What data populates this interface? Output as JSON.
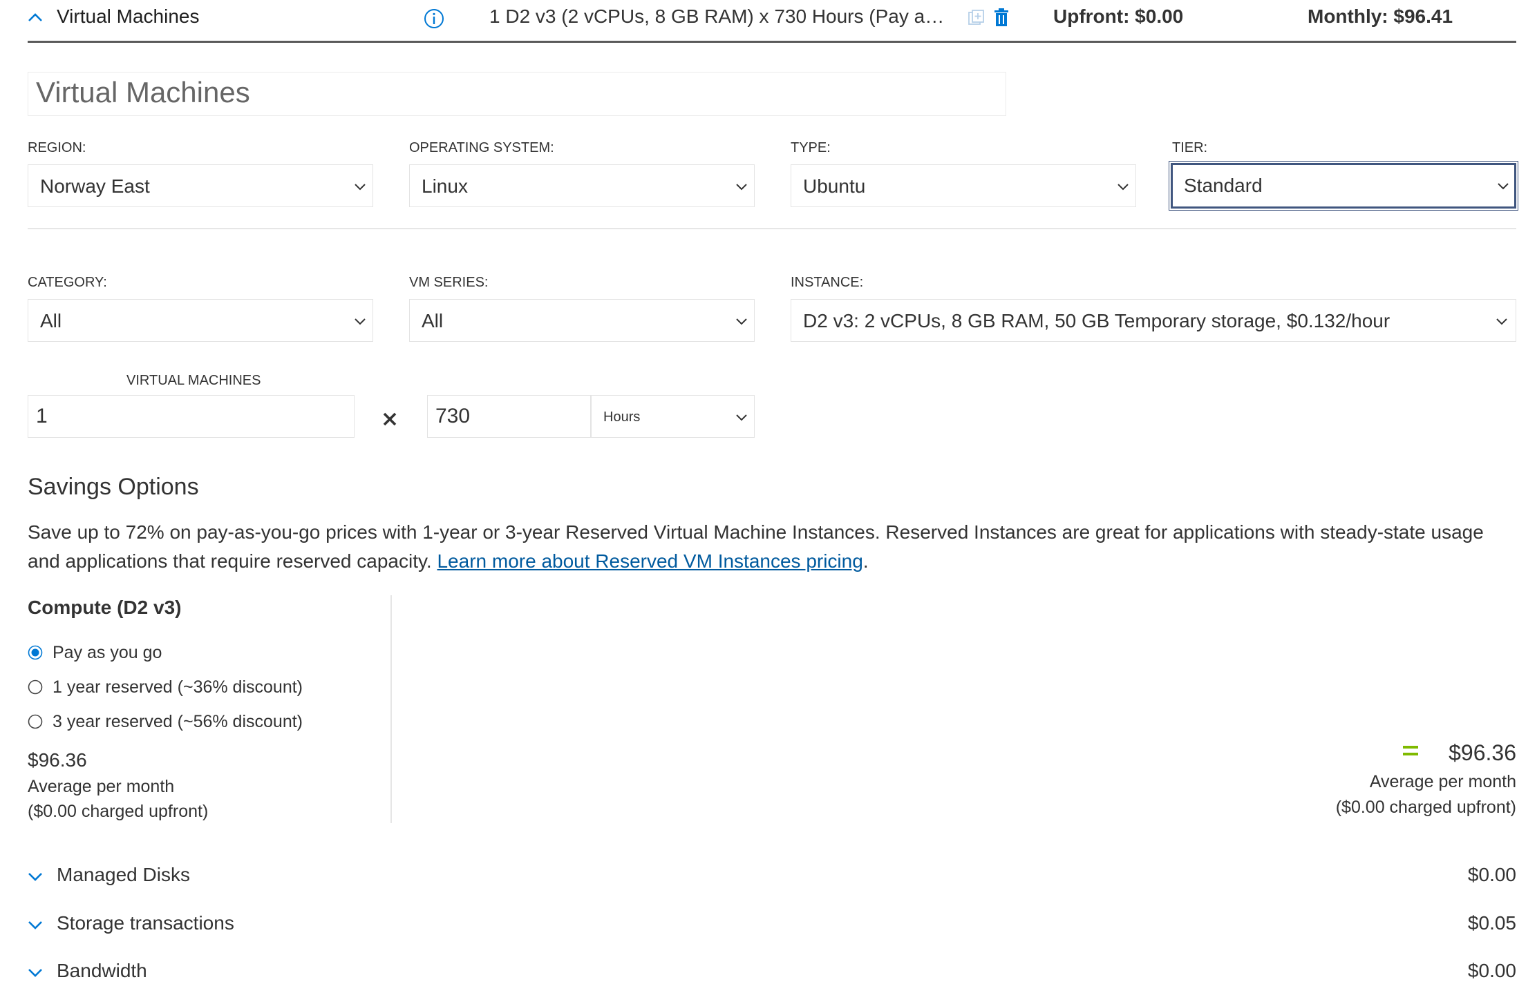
{
  "header": {
    "title": "Virtual Machines",
    "description": "1 D2 v3 (2 vCPUs, 8 GB RAM) x 730 Hours (Pay as yo...",
    "upfront": "Upfront: $0.00",
    "monthly": "Monthly: $96.41",
    "icons": [
      "chevron-up-icon",
      "info-icon",
      "clone-icon",
      "delete-icon"
    ]
  },
  "name_input": {
    "value": "Virtual Machines"
  },
  "fields": {
    "region": {
      "label": "REGION:",
      "value": "Norway East"
    },
    "os": {
      "label": "OPERATING SYSTEM:",
      "value": "Linux"
    },
    "type": {
      "label": "TYPE:",
      "value": "Ubuntu"
    },
    "tier": {
      "label": "TIER:",
      "value": "Standard"
    },
    "category": {
      "label": "CATEGORY:",
      "value": "All"
    },
    "vm_series": {
      "label": "VM SERIES:",
      "value": "All"
    },
    "instance": {
      "label": "INSTANCE:",
      "value": "D2 v3: 2 vCPUs, 8 GB RAM, 50 GB Temporary storage, $0.132/hour"
    }
  },
  "quantity": {
    "label": "VIRTUAL MACHINES",
    "count": "1",
    "multiply": "×",
    "hours": "730",
    "unit": "Hours"
  },
  "savings": {
    "title": "Savings Options",
    "desc_text": "Save up to 72% on pay-as-you-go prices with 1-year or 3-year Reserved Virtual Machine Instances. Reserved Instances are great for applications with steady-state usage and applications that require reserved capacity. ",
    "link_text": "Learn more about Reserved VM Instances pricing",
    "desc_end": ".",
    "compute_title": "Compute (D2 v3)",
    "options": [
      {
        "label": "Pay as you go",
        "selected": true
      },
      {
        "label": "1 year reserved (~36% discount)",
        "selected": false
      },
      {
        "label": "3 year reserved (~56% discount)",
        "selected": false
      }
    ],
    "price": "$96.36",
    "avg_label": "Average per month",
    "upfront_note": "($0.00 charged upfront)"
  },
  "total": {
    "equals": "=",
    "price": "$96.36",
    "avg_label": "Average per month",
    "upfront_note": "($0.00 charged upfront)"
  },
  "sections": [
    {
      "label": "Managed Disks",
      "value": "$0.00"
    },
    {
      "label": "Storage transactions",
      "value": "$0.05"
    },
    {
      "label": "Bandwidth",
      "value": "$0.00"
    }
  ],
  "colors": {
    "accent": "#0078d4",
    "link": "#005a9e",
    "equals": "#7fba00",
    "focus": "#40567f"
  }
}
